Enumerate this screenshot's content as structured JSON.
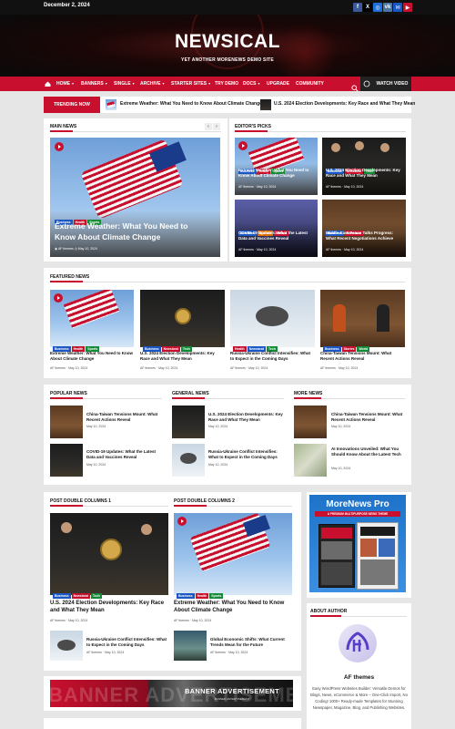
{
  "topbar": {
    "date": "December 2, 2024",
    "social_icons": [
      "facebook-icon",
      "x-icon",
      "instagram-icon",
      "vk-icon",
      "email-icon",
      "youtube-icon"
    ]
  },
  "header": {
    "logo": "NEWSICAL",
    "tagline": "YET ANOTHER MORENEWS DEMO SITE"
  },
  "nav": {
    "items": [
      {
        "label": "HOME",
        "dropdown": true
      },
      {
        "label": "BANNERS",
        "dropdown": true
      },
      {
        "label": "SINGLE",
        "dropdown": true
      },
      {
        "label": "ARCHIVE",
        "dropdown": true
      },
      {
        "label": "STARTER SITES",
        "dropdown": true
      },
      {
        "label": "TRY DEMO",
        "dropdown": false
      },
      {
        "label": "DOCS",
        "dropdown": true
      },
      {
        "label": "UPGRADE",
        "dropdown": false
      },
      {
        "label": "COMMUNITY",
        "dropdown": false
      }
    ],
    "watch_video": "WATCH VIDEO"
  },
  "trending": {
    "label": "TRENDING NOW",
    "items": [
      "Extreme Weather: What You Need to Know About Climate Change",
      "U.S. 2024 Election Developments: Key Race and What They Mean"
    ]
  },
  "main_news": {
    "title": "MAIN NEWS",
    "headline": "Extreme Weather: What You Need to Know About Climate Change",
    "tags": [
      "Business",
      "Health",
      "Sports"
    ],
    "author": "AF themes",
    "date": "May 10, 2024"
  },
  "editors_picks": {
    "title": "EDITOR'S PICKS",
    "items": [
      {
        "title": "Extreme Weather: What You Need to Know About Climate Change",
        "tags": [
          "Business",
          "Health",
          "Sports"
        ],
        "author": "AF themes",
        "date": "May 10, 2024"
      },
      {
        "title": "U.S. 2024 Election Developments: Key Race and What They Mean",
        "tags": [
          "Business",
          "Newsbeat",
          "Tech"
        ],
        "author": "AF themes",
        "date": "May 10, 2024"
      },
      {
        "title": "COVID-19 Updates: What the Latest Data and Vaccines Reveal",
        "tags": [
          "Business",
          "Science",
          "Stories"
        ],
        "author": "AF themes",
        "date": "May 10, 2024"
      },
      {
        "title": "Middle East Peace Talks Progress: What Recent Negotiations Achieve",
        "tags": [
          "Business",
          "Newsbeat"
        ],
        "author": "AF themes",
        "date": "May 10, 2024"
      }
    ]
  },
  "featured_news": {
    "title": "FEATURED NEWS",
    "items": [
      {
        "title": "Extreme Weather: What You Need to Know About Climate Change",
        "tags": [
          "Business",
          "Health",
          "Sports"
        ],
        "author": "AF themes",
        "date": "May 10, 2024"
      },
      {
        "title": "U.S. 2024 Election Developments: Key Race and What They Mean",
        "tags": [
          "Business",
          "Newsbeat",
          "Tech"
        ],
        "author": "AF themes",
        "date": "May 10, 2024"
      },
      {
        "title": "Russia-Ukraine Conflict Intensifies: What to Expect in the Coming Days",
        "tags": [
          "Health",
          "Newsbeat",
          "Tech"
        ],
        "author": "AF themes",
        "date": "May 10, 2024"
      },
      {
        "title": "China-Taiwan Tensions Mount: What Recent Actions Reveal",
        "tags": [
          "Business",
          "Stories",
          "World"
        ],
        "author": "AF themes",
        "date": "May 10, 2024"
      }
    ]
  },
  "popular_news": {
    "title": "POPULAR NEWS",
    "items": [
      {
        "title": "China-Taiwan Tensions Mount: What Recent Actions Reveal",
        "date": "May 10, 2024"
      },
      {
        "title": "COVID-19 Updates: What the Latest Data and Vaccines Reveal",
        "date": "May 10, 2024"
      }
    ]
  },
  "general_news": {
    "title": "GENERAL NEWS",
    "items": [
      {
        "title": "U.S. 2024 Election Developments: Key Race and What They Mean",
        "date": "May 10, 2024"
      },
      {
        "title": "Russia-Ukraine Conflict Intensifies: What to Expect in the Coming Days",
        "date": "May 10, 2024"
      }
    ]
  },
  "more_news": {
    "title": "MORE NEWS",
    "items": [
      {
        "title": "China-Taiwan Tensions Mount: What Recent Actions Reveal",
        "date": "May 10, 2024"
      },
      {
        "title": "AI Innovations Unveiled: What You Should Know About the Latest Tech",
        "date": "May 10, 2024"
      }
    ]
  },
  "post_double_1": {
    "title": "POST DOUBLE COLUMNS 1",
    "main": {
      "title": "U.S. 2024 Election Developments: Key Race and What They Mean",
      "tags": [
        "Business",
        "Newsbeat",
        "Tech"
      ],
      "author": "AF themes",
      "date": "May 10, 2024"
    },
    "sub": {
      "title": "Russia-Ukraine Conflict Intensifies: What to Expect in the Coming Days",
      "author": "AF themes",
      "date": "May 10, 2024"
    }
  },
  "post_double_2": {
    "title": "POST DOUBLE COLUMNS 2",
    "main": {
      "title": "Extreme Weather: What You Need to Know About Climate Change",
      "tags": [
        "Business",
        "Health",
        "Sports"
      ],
      "author": "AF themes",
      "date": "May 10, 2024"
    },
    "sub": {
      "title": "Global Economic Shifts: What Current Trends Mean for the Future",
      "author": "AF themes",
      "date": "May 10, 2024"
    }
  },
  "promo": {
    "title": "MoreNews Pro",
    "subtitle": "A PREMIUM MULTIPURPOSE NEWS THEME"
  },
  "about": {
    "title": "ABOUT AUTHOR",
    "name": "AF themes",
    "bio": "Easy WordPress Websites Builder: Versatile Demos for Blogs, News, eCommerce & More – One-Click Import, No Coding! 1000+ Ready-made Templates for Stunning Newspaper, Magazine, Blog, and Publishing Websites."
  },
  "ad_banner": {
    "bg_text": "BANNER ADVERTISEMENT",
    "title": "BANNER ADVERTISEMENT",
    "sub": "BANNER ADVERTISEMENT"
  },
  "colors": {
    "accent": "#c8102e",
    "dark": "#111111",
    "tag_blue": "#1a57c4",
    "tag_green": "#138a36",
    "tag_orange": "#e06b00"
  }
}
